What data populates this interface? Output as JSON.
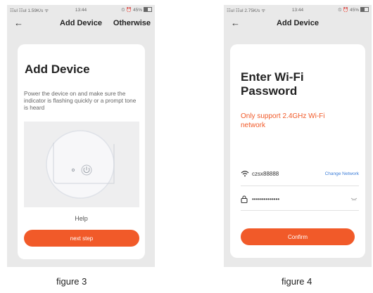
{
  "screen1": {
    "status": {
      "left": "☷ul ☷ul 1.59K/s ᯤ",
      "time": "13:44",
      "right": "⏲ ⏰ 45%"
    },
    "nav": {
      "back_icon": "arrow-left-icon",
      "title": "Add Device",
      "right": "Otherwise"
    },
    "card": {
      "title": "Add Device",
      "description": "Power the device on and make sure the indicator is flashing quickly or a prompt tone is heard",
      "help": "Help",
      "next_button": "next step"
    }
  },
  "screen2": {
    "status": {
      "left": "☷ul ☷ul 2.75K/s ᯤ",
      "time": "13:44",
      "right": "⏲ ⏰ 45%"
    },
    "nav": {
      "back_icon": "arrow-left-icon",
      "title": "Add Device"
    },
    "card": {
      "title": "Enter Wi-Fi Password",
      "note": "Only support 2.4GHz Wi-Fi network",
      "ssid": "czsx88888",
      "change_network": "Change Network",
      "password": "••••••••••••••",
      "confirm_button": "Confirm"
    }
  },
  "captions": {
    "left": "figure 3",
    "right": "figure 4"
  },
  "colors": {
    "accent": "#f15a29",
    "link": "#3d7ed8",
    "phone_bg": "#e9e9e9"
  }
}
